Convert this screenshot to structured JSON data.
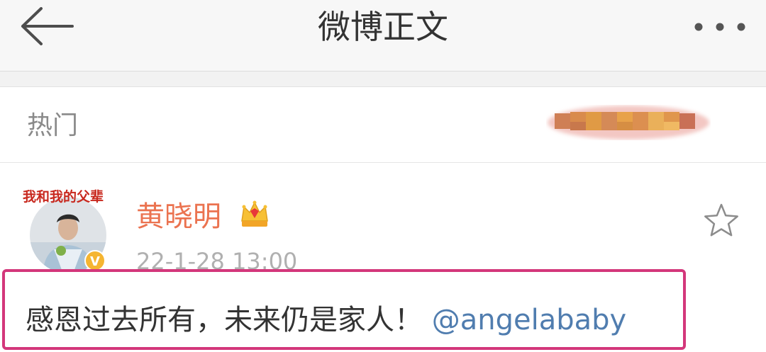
{
  "header": {
    "title": "微博正文",
    "back_icon": "arrow-left-icon",
    "more_icon": "more-dots-icon"
  },
  "tag_row": {
    "label": "热门",
    "redacted": "blurred-username"
  },
  "post": {
    "author": "黄晓明",
    "time": "22-1-28 13:00",
    "avatar_text": "我和我的父辈",
    "verified_badge": "V",
    "text": "感恩过去所有，未来仍是家人！",
    "mention": "@angelababy",
    "favorite_icon": "star-outline-icon",
    "crown_icon": "crown-icon"
  },
  "colors": {
    "name": "#eb7350",
    "mention": "#507daf",
    "highlight": "#d3377b",
    "badge": "#f5b531"
  }
}
